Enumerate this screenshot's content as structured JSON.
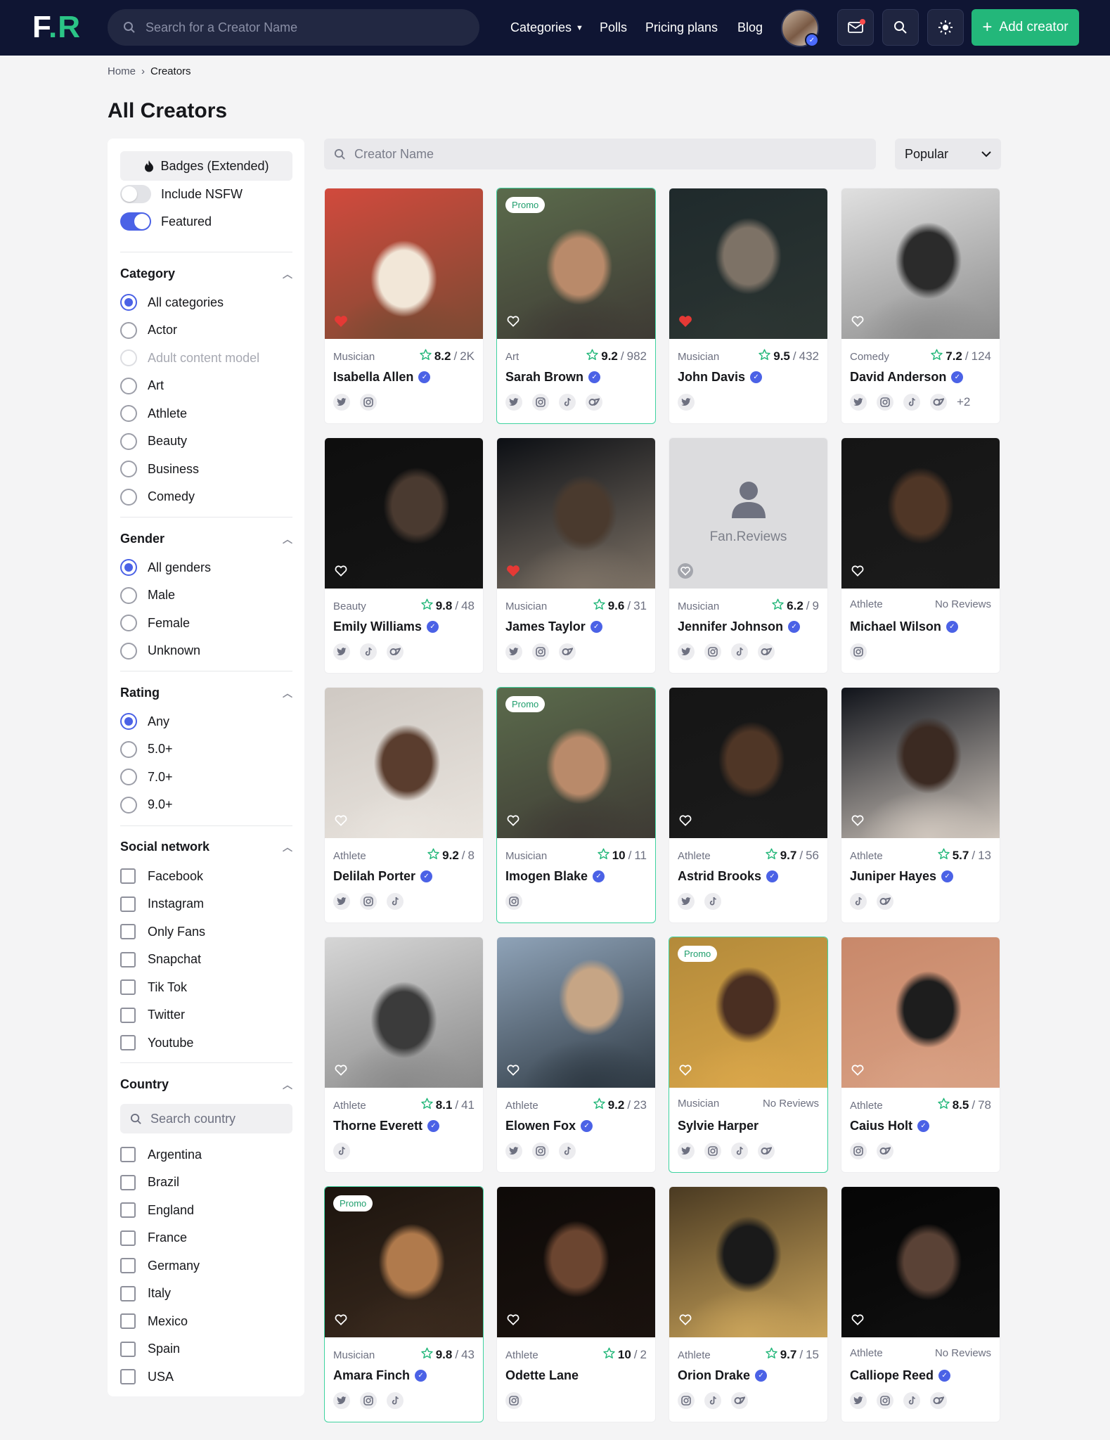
{
  "header": {
    "logo_left": "F",
    "logo_dot": ".",
    "logo_right": "R",
    "search_placeholder": "Search for a Creator Name",
    "nav": {
      "categories": "Categories",
      "polls": "Polls",
      "pricing": "Pricing plans",
      "blog": "Blog"
    },
    "add_creator": "Add creator"
  },
  "breadcrumb": {
    "home": "Home",
    "current": "Creators"
  },
  "page_title": "All Creators",
  "sidebar": {
    "badges_label": "Badges (Extended)",
    "toggles": [
      {
        "label": "Include NSFW",
        "on": false
      },
      {
        "label": "Featured",
        "on": true
      }
    ],
    "category": {
      "title": "Category",
      "options": [
        "All categories",
        "Actor",
        "Adult content model",
        "Art",
        "Athlete",
        "Beauty",
        "Business",
        "Comedy"
      ],
      "selected": "All categories",
      "disabled": [
        "Adult content model"
      ]
    },
    "gender": {
      "title": "Gender",
      "options": [
        "All genders",
        "Male",
        "Female",
        "Unknown"
      ],
      "selected": "All genders"
    },
    "rating": {
      "title": "Rating",
      "options": [
        "Any",
        "5.0+",
        "7.0+",
        "9.0+"
      ],
      "selected": "Any"
    },
    "social": {
      "title": "Social network",
      "options": [
        "Facebook",
        "Instagram",
        "Only Fans",
        "Snapchat",
        "Tik Tok",
        "Twitter",
        "Youtube"
      ]
    },
    "country": {
      "title": "Country",
      "search_placeholder": "Search country",
      "options": [
        "Argentina",
        "Brazil",
        "England",
        "France",
        "Germany",
        "Italy",
        "Mexico",
        "Spain",
        "USA"
      ]
    }
  },
  "main": {
    "search_placeholder": "Creator Name",
    "sort_value": "Popular",
    "promo_label": "Promo",
    "no_reviews_label": "No Reviews",
    "placeholder_brand": "Fan.Reviews",
    "cards": [
      {
        "category": "Musician",
        "score": "8.2",
        "count": "2K",
        "name": "Isabella Allen",
        "promo": false,
        "liked": true,
        "socials": [
          "twitter",
          "instagram"
        ],
        "photo_colors": [
          "#d14a3d",
          "#f2e7d8",
          "#7b4a33"
        ]
      },
      {
        "category": "Art",
        "score": "9.2",
        "count": "982",
        "name": "Sarah Brown",
        "promo": true,
        "liked": false,
        "socials": [
          "twitter",
          "instagram",
          "tiktok",
          "onlyfans"
        ],
        "photo_colors": [
          "#5b6b4c",
          "#b98a6a",
          "#3e3a34"
        ]
      },
      {
        "category": "Musician",
        "score": "9.5",
        "count": "432",
        "name": "John Davis",
        "promo": false,
        "liked": true,
        "socials": [
          "twitter"
        ],
        "photo_colors": [
          "#1f2a2c",
          "#7d7266",
          "#2c3532"
        ]
      },
      {
        "category": "Comedy",
        "score": "7.2",
        "count": "124",
        "name": "David Anderson",
        "promo": false,
        "liked": false,
        "socials": [
          "twitter",
          "instagram",
          "tiktok",
          "onlyfans"
        ],
        "more": "+2",
        "photo_colors": [
          "#e0e0e0",
          "#2b2b2b",
          "#8c8c8c"
        ]
      },
      {
        "category": "Beauty",
        "score": "9.8",
        "count": "48",
        "name": "Emily Williams",
        "promo": false,
        "liked": false,
        "socials": [
          "twitter",
          "tiktok",
          "onlyfans"
        ],
        "photo_colors": [
          "#0e0e0e",
          "#4a3a30",
          "#151515"
        ]
      },
      {
        "category": "Musician",
        "score": "9.6",
        "count": "31",
        "name": "James Taylor",
        "promo": false,
        "liked": true,
        "socials": [
          "twitter",
          "instagram",
          "onlyfans"
        ],
        "photo_colors": [
          "#0c0f14",
          "#4a3a2e",
          "#7d7266"
        ]
      },
      {
        "category": "Musician",
        "score": "6.2",
        "count": "9",
        "name": "Jennifer Johnson",
        "promo": false,
        "liked": false,
        "placeholder": true,
        "socials": [
          "twitter",
          "instagram",
          "tiktok",
          "onlyfans"
        ],
        "photo_colors": [
          "#dcdcde",
          "#dcdcde",
          "#dcdcde"
        ]
      },
      {
        "category": "Athlete",
        "score": "",
        "count": "",
        "name": "Michael Wilson",
        "promo": false,
        "liked": false,
        "socials": [
          "instagram"
        ],
        "photo_colors": [
          "#151515",
          "#4f3626",
          "#1b1b1b"
        ]
      },
      {
        "category": "Athlete",
        "score": "9.2",
        "count": "8",
        "name": "Delilah Porter",
        "promo": false,
        "liked": false,
        "socials": [
          "twitter",
          "instagram",
          "tiktok"
        ],
        "photo_colors": [
          "#cfc9c3",
          "#5a3d2e",
          "#e9e4de"
        ]
      },
      {
        "category": "Musician",
        "score": "10",
        "count": "11",
        "name": "Imogen Blake",
        "promo": true,
        "liked": false,
        "socials": [
          "instagram"
        ],
        "photo_colors": [
          "#5b6b4c",
          "#b98a6a",
          "#3e3a34"
        ]
      },
      {
        "category": "Athlete",
        "score": "9.7",
        "count": "56",
        "name": "Astrid Brooks",
        "promo": false,
        "liked": false,
        "socials": [
          "twitter",
          "tiktok"
        ],
        "photo_colors": [
          "#151515",
          "#4f3626",
          "#1b1b1b"
        ]
      },
      {
        "category": "Athlete",
        "score": "5.7",
        "count": "13",
        "name": "Juniper Hayes",
        "promo": false,
        "liked": false,
        "socials": [
          "tiktok",
          "onlyfans"
        ],
        "photo_colors": [
          "#10131a",
          "#3b2a22",
          "#cfc6bd"
        ]
      },
      {
        "category": "Athlete",
        "score": "8.1",
        "count": "41",
        "name": "Thorne Everett",
        "promo": false,
        "liked": false,
        "socials": [
          "tiktok"
        ],
        "photo_colors": [
          "#d6d6d6",
          "#3b3b3b",
          "#8a8a8a"
        ]
      },
      {
        "category": "Athlete",
        "score": "9.2",
        "count": "23",
        "name": "Elowen Fox",
        "promo": false,
        "liked": false,
        "socials": [
          "twitter",
          "instagram",
          "tiktok"
        ],
        "photo_colors": [
          "#8fa3b8",
          "#c6a585",
          "#2f3a44"
        ]
      },
      {
        "category": "Musician",
        "score": "",
        "count": "",
        "name": "Sylvie Harper",
        "promo": true,
        "liked": false,
        "socials": [
          "twitter",
          "instagram",
          "tiktok",
          "onlyfans"
        ],
        "photo_colors": [
          "#b38a3a",
          "#4a2f22",
          "#d9a64a"
        ]
      },
      {
        "category": "Athlete",
        "score": "8.5",
        "count": "78",
        "name": "Caius Holt",
        "promo": false,
        "liked": false,
        "socials": [
          "instagram",
          "onlyfans"
        ],
        "photo_colors": [
          "#c8886a",
          "#1d1d1d",
          "#d9a184"
        ]
      },
      {
        "category": "Musician",
        "score": "9.8",
        "count": "43",
        "name": "Amara Finch",
        "promo": true,
        "liked": false,
        "socials": [
          "twitter",
          "instagram",
          "tiktok"
        ],
        "photo_colors": [
          "#1c140e",
          "#b07a4c",
          "#3a2a1e"
        ]
      },
      {
        "category": "Athlete",
        "score": "10",
        "count": "2",
        "name": "Odette Lane",
        "promo": false,
        "liked": false,
        "socials": [
          "instagram"
        ],
        "photo_colors": [
          "#0e0a08",
          "#6b4530",
          "#1a120e"
        ]
      },
      {
        "category": "Athlete",
        "score": "9.7",
        "count": "15",
        "name": "Orion Drake",
        "promo": false,
        "liked": false,
        "socials": [
          "instagram",
          "tiktok",
          "onlyfans"
        ],
        "photo_colors": [
          "#4a3a22",
          "#1a1a1a",
          "#c9a35a"
        ]
      },
      {
        "category": "Athlete",
        "score": "",
        "count": "",
        "name": "Calliope Reed",
        "promo": false,
        "liked": false,
        "socials": [
          "twitter",
          "instagram",
          "tiktok",
          "onlyfans"
        ],
        "photo_colors": [
          "#050505",
          "#5a4236",
          "#0f0f0f"
        ]
      }
    ]
  },
  "colors": {
    "navy": "#0f1533",
    "green": "#23b77a",
    "blue": "#4b62e6",
    "promo_border": "#3fd3a0"
  }
}
